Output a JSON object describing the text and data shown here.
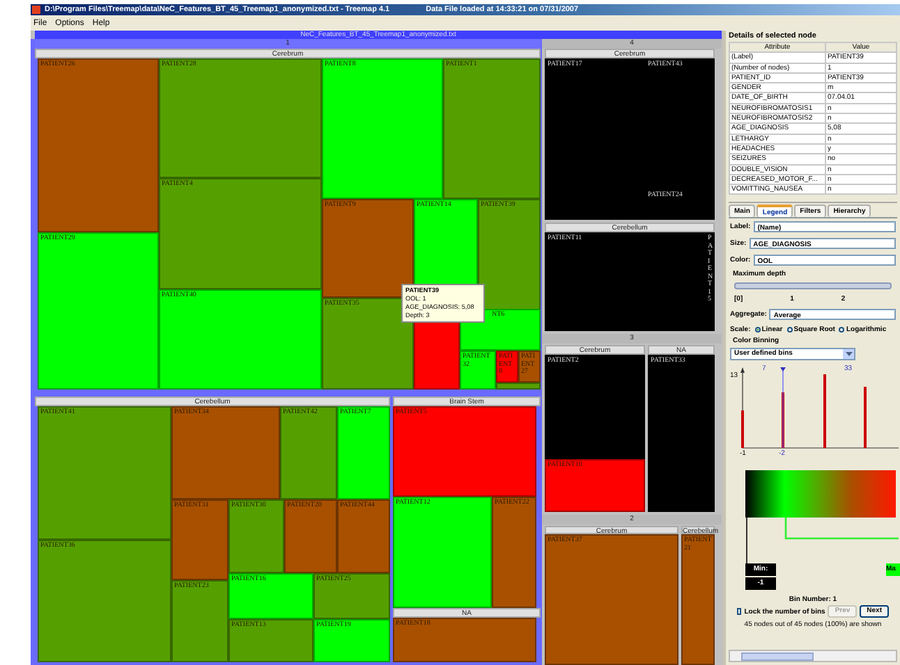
{
  "window": {
    "title": "D:\\Program Files\\Treemap\\data\\NeC_Features_BT_45_Treemap1_anonymized.txt - Treemap 4.1",
    "status": "Data File loaded at 14:33:21 on 07/31/2007"
  },
  "menu": [
    "File",
    "Options",
    "Help"
  ],
  "treemap": {
    "title": "NeC_Features_BT_45_Treemap1_anonymized.txt",
    "groups": [
      {
        "label": "1",
        "selected": true,
        "subgroups": [
          {
            "label": "Cerebrum",
            "cells": [
              {
                "label": "PATIENT26",
                "color": "#a85000"
              },
              {
                "label": "PATIENT29",
                "color": "#00ff00"
              },
              {
                "label": "PATIENT28",
                "color": "#55a000"
              },
              {
                "label": "PATIENT4",
                "color": "#55a000"
              },
              {
                "label": "PATIENT40",
                "color": "#00ff00"
              },
              {
                "label": "PATIENT8",
                "color": "#00ff00"
              },
              {
                "label": "PATIENT1",
                "color": "#55a000"
              },
              {
                "label": "PATIENT9",
                "color": "#a85000"
              },
              {
                "label": "PATIENT14",
                "color": "#00ff00"
              },
              {
                "label": "PATIENT39",
                "color": "#55a000"
              },
              {
                "label": "PATIENT35",
                "color": "#55a000"
              },
              {
                "color": "#ff0000"
              },
              {
                "label": "NT6",
                "color": "#00ff00"
              },
              {
                "label": "PATIENT32",
                "color": "#00ff00"
              },
              {
                "label": "PATIENT0",
                "color": "#ff0000"
              },
              {
                "label": "PATIENT27",
                "color": "#a85000"
              },
              {
                "color": "#55a000"
              }
            ]
          },
          {
            "label": "Cerebellum",
            "cells": [
              {
                "label": "PATIENT41",
                "color": "#55a000"
              },
              {
                "label": "PATIENT36",
                "color": "#55a000"
              },
              {
                "label": "PATIENT34",
                "color": "#a85000"
              },
              {
                "label": "PATIENT42",
                "color": "#55a000"
              },
              {
                "label": "PATIENT7",
                "color": "#00ff00"
              },
              {
                "label": "PATIENT31",
                "color": "#a85000"
              },
              {
                "label": "PATIENT30",
                "color": "#55a000"
              },
              {
                "label": "PATIENT20",
                "color": "#a85000"
              },
              {
                "label": "PATIENT44",
                "color": "#a85000"
              },
              {
                "label": "PATIENT23",
                "color": "#55a000"
              },
              {
                "label": "PATIENT16",
                "color": "#00ff00"
              },
              {
                "label": "PATIENT25",
                "color": "#55a000"
              },
              {
                "label": "PATIENT13",
                "color": "#55a000"
              },
              {
                "label": "PATIENT19",
                "color": "#00ff00"
              }
            ]
          },
          {
            "label": "Brain Stem",
            "cells": [
              {
                "label": "PATIENT5",
                "color": "#ff0000"
              },
              {
                "label": "PATIENT12",
                "color": "#00ff00"
              },
              {
                "label": "PATIENT22",
                "color": "#a85000"
              }
            ]
          },
          {
            "label": "NA",
            "cells": [
              {
                "label": "PATIENT18",
                "color": "#a85000"
              }
            ]
          }
        ]
      },
      {
        "label": "4",
        "selected": false,
        "subgroups": [
          {
            "label": "Cerebrum",
            "cells": [
              {
                "label": "PATIENT17",
                "color": "#000000"
              },
              {
                "label": "PATIENT43",
                "color": "#000000"
              },
              {
                "label": "PATIENT24",
                "color": "#000000"
              }
            ]
          },
          {
            "label": "Cerebellum",
            "cells": [
              {
                "label": "PATIENT11",
                "color": "#000000"
              },
              {
                "label": "PATIENT15",
                "color": "#000000"
              }
            ]
          }
        ]
      },
      {
        "label": "3",
        "selected": false,
        "subgroups": [
          {
            "label": "Cerebrum",
            "cells": [
              {
                "label": "PATIENT2",
                "color": "#000000"
              },
              {
                "label": "PATIENT10",
                "color": "#ff0000"
              }
            ]
          },
          {
            "label": "NA",
            "cells": [
              {
                "label": "PATIENT33",
                "color": "#000000"
              }
            ]
          }
        ]
      },
      {
        "label": "2",
        "selected": false,
        "subgroups": [
          {
            "label": "Cerebrum",
            "cells": [
              {
                "label": "PATIENT37",
                "color": "#a85000"
              }
            ]
          },
          {
            "label": "Cerebellum",
            "cells": [
              {
                "label": "PATIENT21",
                "color": "#a85000"
              }
            ]
          }
        ]
      }
    ]
  },
  "tooltip": {
    "title": "PATIENT39",
    "lines": [
      "OOL: 1",
      "AGE_DIAGNOSIS: 5,08",
      "Depth: 3"
    ]
  },
  "details": {
    "title": "Details of selected node",
    "columns": [
      "Attribute",
      "Value"
    ],
    "rows": [
      [
        "(Label)",
        "PATIENT39"
      ],
      [
        "(Number of nodes)",
        "1"
      ],
      [
        "PATIENT_ID",
        "PATIENT39"
      ],
      [
        "GENDER",
        "m"
      ],
      [
        "DATE_OF_BIRTH",
        "07.04.01"
      ],
      [
        "NEUROFIBROMATOSIS1",
        "n"
      ],
      [
        "NEUROFIBROMATOSIS2",
        "n"
      ],
      [
        "AGE_DIAGNOSIS",
        "5,08"
      ],
      [
        "LETHARGY",
        "n"
      ],
      [
        "HEADACHES",
        "y"
      ],
      [
        "SEIZURES",
        "no"
      ],
      [
        "DOUBLE_VISION",
        "n"
      ],
      [
        "DECREASED_MOTOR_F...",
        "n"
      ],
      [
        "VOMITTING_NAUSEA",
        "n"
      ]
    ]
  },
  "legend": {
    "tabs": [
      {
        "label": "Main",
        "selected": false
      },
      {
        "label": "Legend",
        "selected": true
      },
      {
        "label": "Filters",
        "selected": false
      },
      {
        "label": "Hierarchy",
        "selected": false
      }
    ],
    "fields": [
      {
        "label": "Label:",
        "value": "(Name)"
      },
      {
        "label": "Size:",
        "value": "AGE_DIAGNOSIS"
      },
      {
        "label": "Color:",
        "value": "OOL"
      }
    ],
    "max_depth": {
      "label": "Maximum depth",
      "ticks": [
        "[0]",
        "1",
        "2"
      ]
    },
    "aggregate": {
      "label": "Aggregate:",
      "value": "Average"
    },
    "scale": {
      "label": "Scale:",
      "options": [
        {
          "label": "Linear",
          "selected": true
        },
        {
          "label": "Square Root",
          "selected": false
        },
        {
          "label": "Logarithmic",
          "selected": false
        }
      ]
    },
    "binning": {
      "label": "Color Binning",
      "value": "User defined bins"
    },
    "histogram": {
      "y_label": "13",
      "top_labels": [
        "7",
        "33"
      ],
      "bottom_labels": [
        "-1",
        "-2"
      ]
    },
    "min": {
      "label": "Min:",
      "value": "-1"
    },
    "max": {
      "label": "Ma"
    },
    "bin_number": "Bin Number: 1",
    "lock": {
      "label": "Lock the number of bins",
      "checked": false
    },
    "buttons": [
      {
        "label": "Prev",
        "disabled": true
      },
      {
        "label": "Next",
        "disabled": false
      }
    ],
    "summary": "45 nodes out of 45 nodes (100%) are shown"
  }
}
